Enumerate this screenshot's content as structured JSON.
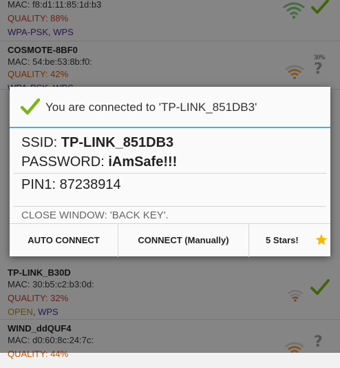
{
  "networks": [
    {
      "mac": "MAC: f8:d1:11:85:1d:b3",
      "quality": "QUALITY: 88%",
      "security": "WPA-PSK, WPS"
    },
    {
      "name": "COSMOTE-8BF0",
      "mac": "MAC: 54:be:53:8b:f0:",
      "quality": "QUALITY: 42%",
      "security": "WPA-PSK, WPS",
      "percent_label": "30%"
    },
    {
      "name": "TP-LINK_B30D",
      "mac": "MAC: 30:b5:c2:b3:0d:",
      "quality": "QUALITY: 32%",
      "security_open": "OPEN",
      "security_rest": ", WPS"
    },
    {
      "name": "WIND_ddQUF4",
      "mac": "MAC: d0:60:8c:24:7c:",
      "quality": "QUALITY: 44%"
    }
  ],
  "dialog": {
    "title": "You are connected to 'TP-LINK_851DB3'",
    "ssid_label": "SSID: ",
    "ssid_value": "TP-LINK_851DB3",
    "password_label": "PASSWORD: ",
    "password_value": "iAmSafe!!!",
    "pin": "PIN1: 87238914",
    "close_hint": "CLOSE WINDOW: 'BACK KEY'.",
    "buttons": {
      "auto_connect": "AUTO CONNECT",
      "connect_manual": "CONNECT (Manually)",
      "rate": "5 Stars!"
    }
  },
  "icons": [
    "wifi-icon",
    "check-icon",
    "question-icon",
    "star-icon"
  ],
  "colors": {
    "accent": "#33b5e5",
    "check": "#7cb518",
    "star": "#f5b800",
    "wifi_green": "#7cc576",
    "wifi_orange": "#e9a23b",
    "quality_red": "#c0392b"
  }
}
